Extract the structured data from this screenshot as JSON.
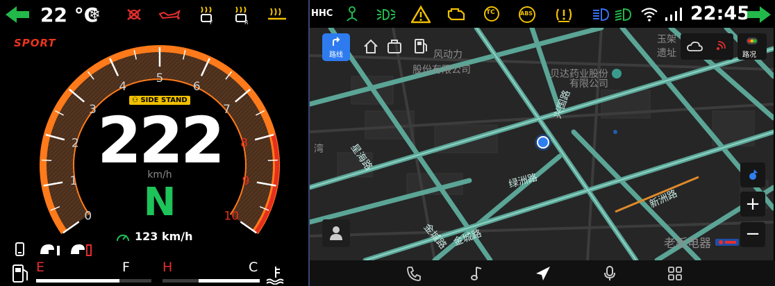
{
  "cluster": {
    "temperature": "22 °C",
    "mode": "SPORT",
    "side_stand": "SIDE STAND",
    "speed": "222",
    "speed_unit": "km/h",
    "gear": "N",
    "cruise_speed": "123 km/h",
    "rpm_scale": [
      "0",
      "1",
      "2",
      "3",
      "4",
      "5",
      "6",
      "7",
      "8",
      "9",
      "10"
    ],
    "fuel": {
      "empty_label": "E",
      "full_label": "F",
      "level": 0.72
    },
    "coolant": {
      "hot_label": "H",
      "cold_label": "C",
      "level": 0.63
    },
    "colors": {
      "accent_orange": "#ff7a1a",
      "gauge_fill": "#4a2f1c",
      "redzone": "#e62e1e",
      "gear_green": "#1ec35a",
      "warning_red": "#e62e2e"
    }
  },
  "status_bar": {
    "hhc_label": "HHC",
    "abs_label": "ABS",
    "tc_label": "TC",
    "time": "22:45"
  },
  "map": {
    "route_button_label": "路线",
    "traffic_button_label": "路况",
    "poi_labels": [
      "风动力",
      "股份有限公司",
      "贝达药业股份",
      "有限公司",
      "玉架",
      "遗址",
      "老板电器",
      "湾"
    ],
    "road_labels": [
      "兴国路",
      "绿洲路",
      "新洲路",
      "金城路",
      "星海路",
      "金城路"
    ],
    "zoom_in": "+",
    "zoom_out": "−"
  }
}
